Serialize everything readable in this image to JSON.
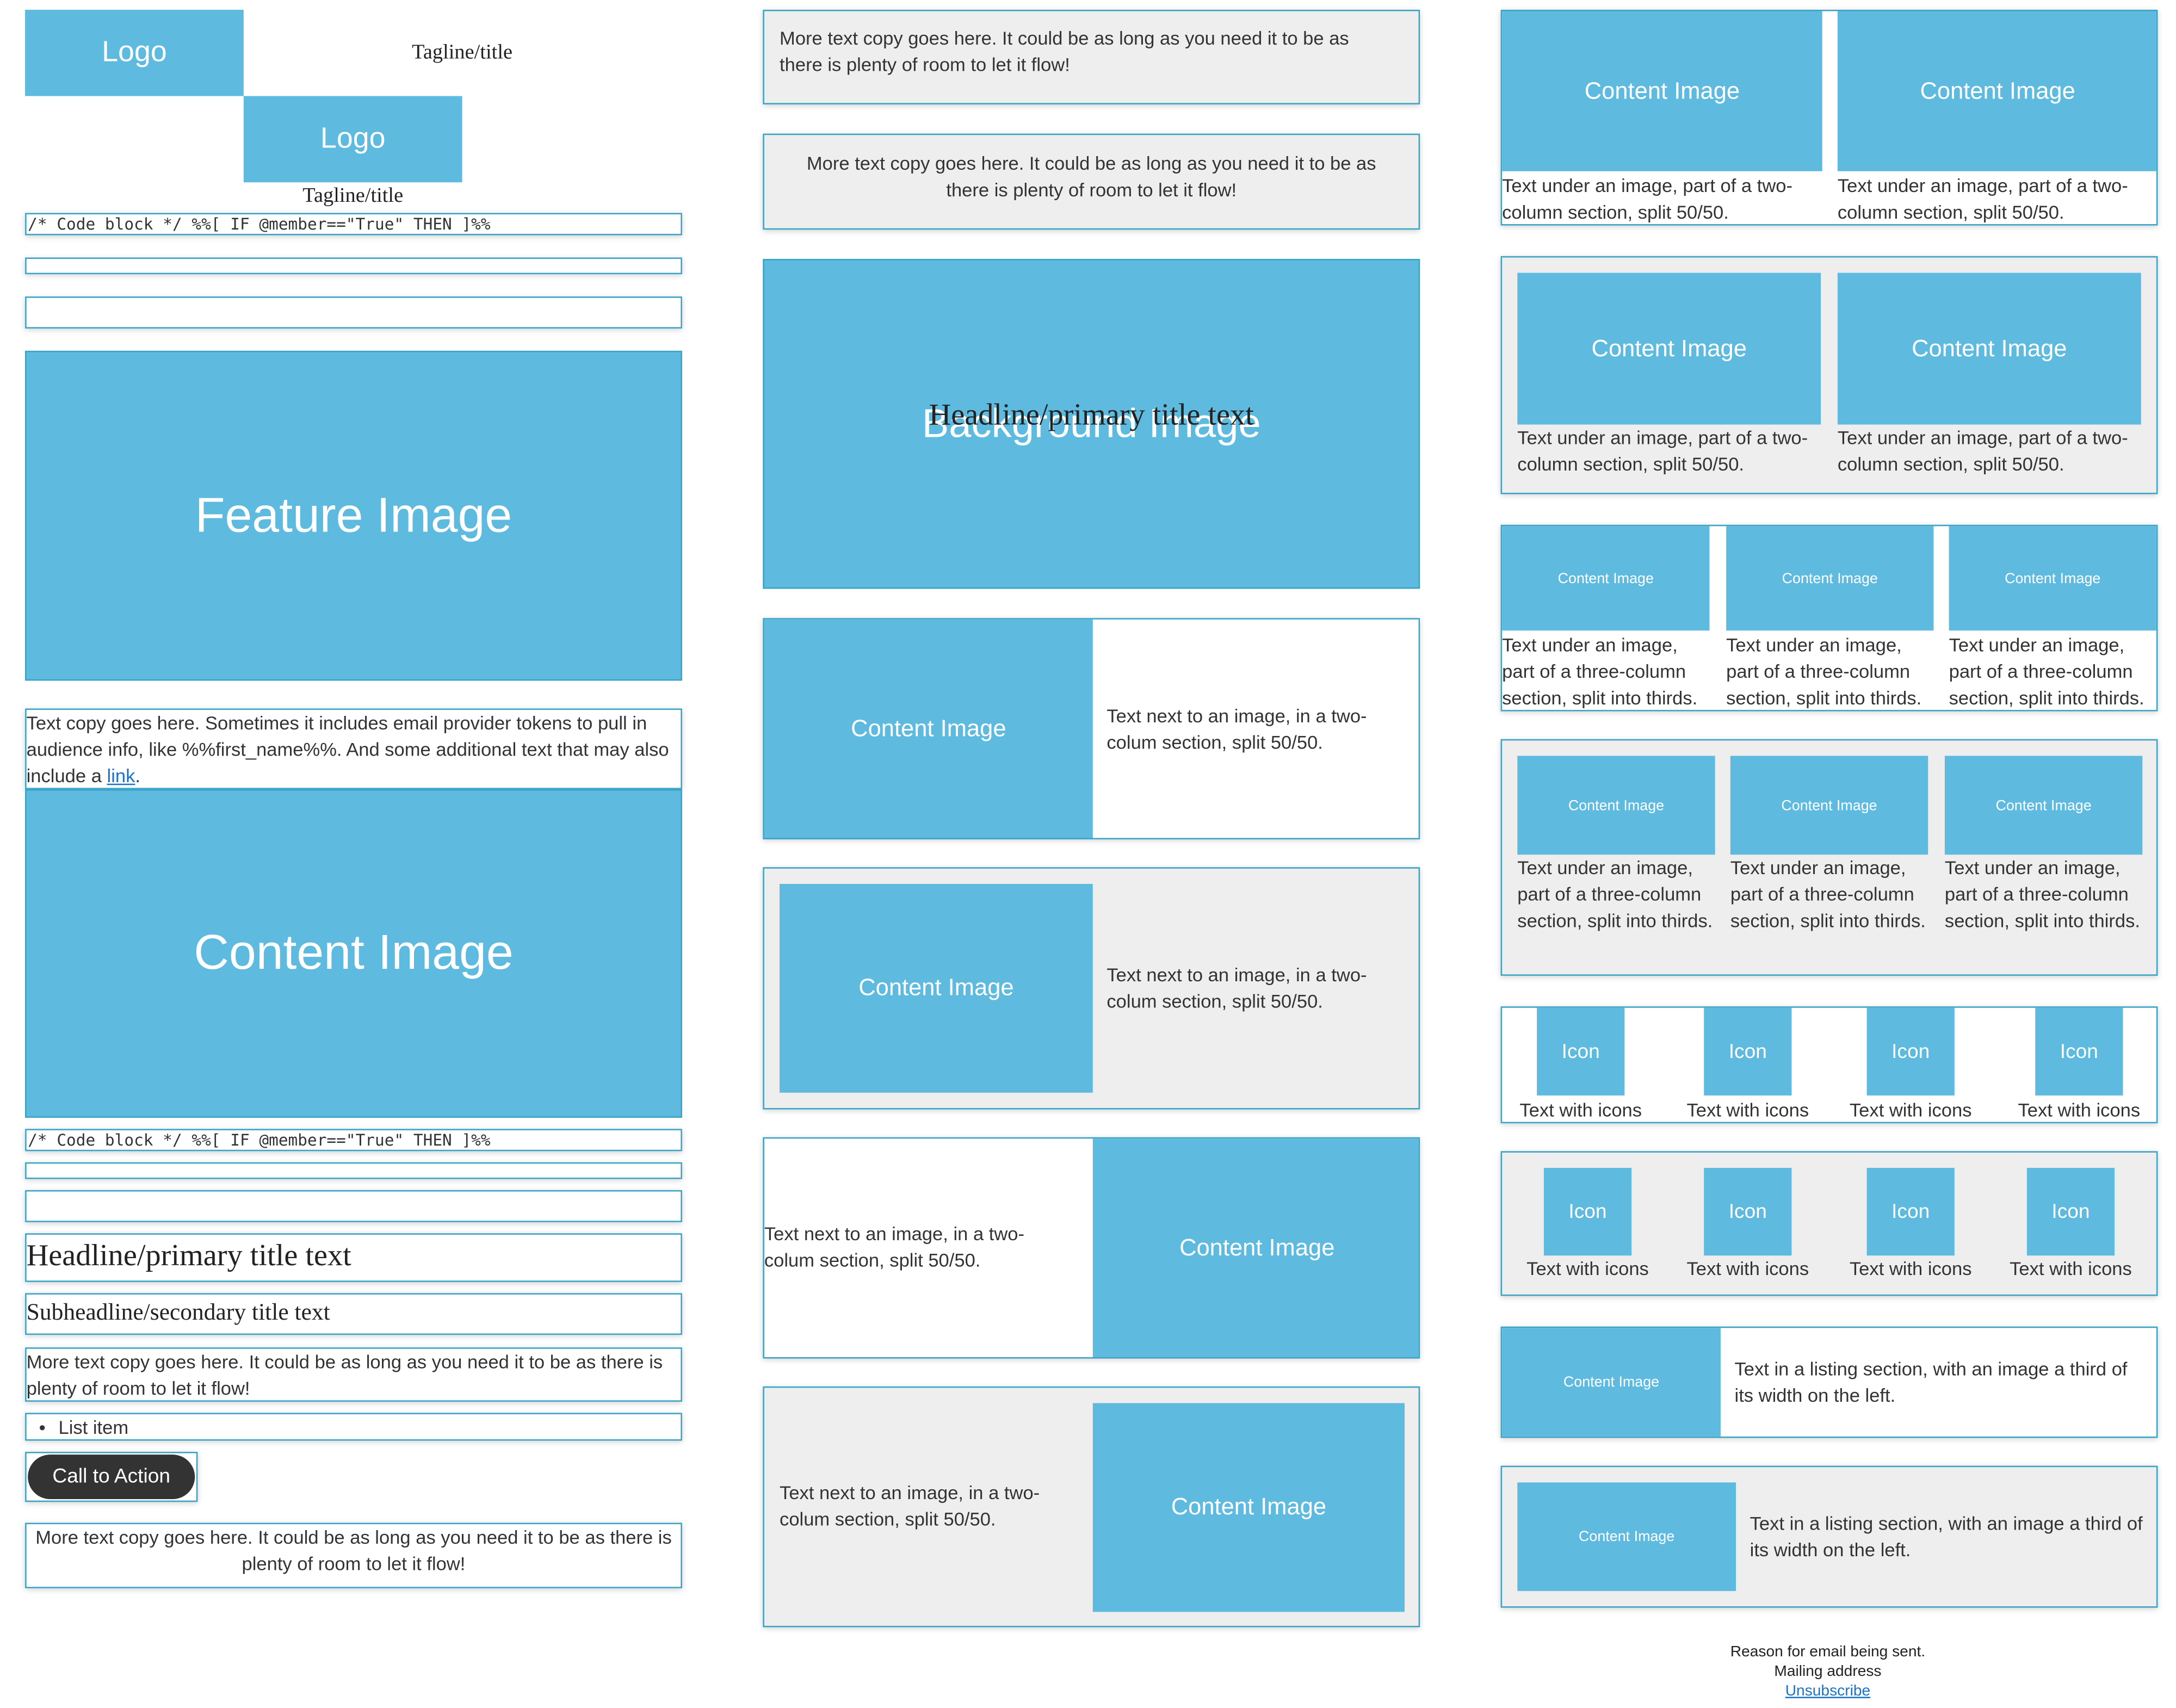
{
  "colors": {
    "image_fill": "#5ebadf",
    "block_border": "#3aa3c6",
    "gray_fill": "#eeeeee",
    "cta_fill": "#333333",
    "link": "#1a73c4"
  },
  "header": {
    "logo": "Logo",
    "tagline": "Tagline/title",
    "logo_2": "Logo",
    "tagline_2": "Tagline/title"
  },
  "code_block": "/* Code block */ %%[ IF @member==\"True\" THEN ]%%",
  "code_block_2": "/* Code block */ %%[ IF @member==\"True\" THEN ]%%",
  "feature_image": "Feature Image",
  "intro": {
    "text_before_link": "Text copy goes here. Sometimes it includes email provider tokens to pull in audience info, like %%first_name%%. And some additional text that may also include a ",
    "link": "link",
    "text_after_link": "."
  },
  "content_image_large": "Content Image",
  "headline": "Headline/primary title text",
  "subheadline": "Subheadline/secondary title text",
  "more_copy": "More text copy goes here. It could be as long as you need it to be as there is plenty of room to let it flow!",
  "list_item": "List item",
  "cta": "Call to Action",
  "more_copy_centered": "More text copy goes here. It could be as long as you need it to be as there is plenty of room to let it flow!",
  "middle": {
    "copy_left": "More text copy goes here. It could be as long as you need it to be as there is plenty of room to let it flow!",
    "copy_center": "More text copy goes here. It could be as long as you need it to be as there is plenty of room to let it flow!",
    "background_image": "Background Image",
    "background_headline": "Headline/primary title text",
    "two_col": [
      {
        "image": "Content Image",
        "text": "Text next to an image, in a two-colum section, split 50/50."
      },
      {
        "image": "Content Image",
        "text": "Text next to an image, in a two-colum section, split 50/50."
      },
      {
        "image": "Content Image",
        "text": "Text next to an image, in a two-colum section, split 50/50."
      },
      {
        "image": "Content Image",
        "text": "Text next to an image, in a two-colum section, split 50/50."
      }
    ]
  },
  "right": {
    "two_col_a": [
      {
        "image": "Content Image",
        "text": "Text under an image, part of a two-column section, split 50/50."
      },
      {
        "image": "Content Image",
        "text": "Text under an image, part of a two-column section, split 50/50."
      }
    ],
    "two_col_b": [
      {
        "image": "Content Image",
        "text": "Text under an image, part of a two-column section, split 50/50."
      },
      {
        "image": "Content Image",
        "text": "Text under an image, part of a two-column section, split 50/50."
      }
    ],
    "three_col_a": [
      {
        "image": "Content Image",
        "text": "Text under an image, part of a three-column section, split into thirds."
      },
      {
        "image": "Content Image",
        "text": "Text under an image, part of a three-column section, split into thirds."
      },
      {
        "image": "Content Image",
        "text": "Text under an image, part of a three-column section, split into thirds."
      }
    ],
    "three_col_b": [
      {
        "image": "Content Image",
        "text": "Text under an image, part of a three-column section, split into thirds."
      },
      {
        "image": "Content Image",
        "text": "Text under an image, part of a three-column section, split into thirds."
      },
      {
        "image": "Content Image",
        "text": "Text under an image, part of a three-column section, split into thirds."
      }
    ],
    "icons_a": [
      {
        "icon": "Icon",
        "text": "Text with icons"
      },
      {
        "icon": "Icon",
        "text": "Text with icons"
      },
      {
        "icon": "Icon",
        "text": "Text with icons"
      },
      {
        "icon": "Icon",
        "text": "Text with icons"
      }
    ],
    "icons_b": [
      {
        "icon": "Icon",
        "text": "Text with icons"
      },
      {
        "icon": "Icon",
        "text": "Text with icons"
      },
      {
        "icon": "Icon",
        "text": "Text with icons"
      },
      {
        "icon": "Icon",
        "text": "Text with icons"
      }
    ],
    "listing": [
      {
        "image": "Content Image",
        "text": "Text in a listing section, with an image a third of its width on the left."
      },
      {
        "image": "Content Image",
        "text": "Text in a listing section, with an image a third of its width on the left."
      }
    ]
  },
  "footer": {
    "reason": "Reason for email being sent.",
    "address": "Mailing address",
    "unsubscribe": "Unsubscribe"
  }
}
